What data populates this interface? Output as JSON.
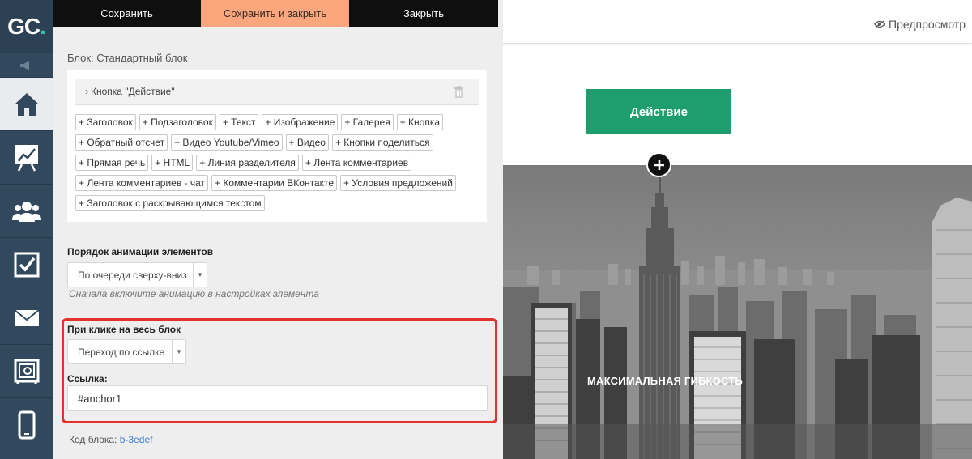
{
  "logo": {
    "text": "GC",
    "dot": "."
  },
  "nav": {
    "items": [
      {
        "icon": "home-icon"
      },
      {
        "icon": "chart-board-icon"
      },
      {
        "icon": "users-icon"
      },
      {
        "icon": "checkbox-icon"
      },
      {
        "icon": "mail-icon"
      },
      {
        "icon": "safe-icon"
      },
      {
        "icon": "mobile-icon"
      }
    ]
  },
  "toolbar": {
    "save_label": "Сохранить",
    "save_close_label": "Сохранить и закрыть",
    "close_label": "Закрыть"
  },
  "editor": {
    "block_title": "Блок: Стандартный блок",
    "element_name": "Кнопка \"Действие\"",
    "add_tags": [
      "+ Заголовок",
      "+ Подзаголовок",
      "+ Текст",
      "+ Изображение",
      "+ Галерея",
      "+ Кнопка",
      "+ Обратный отсчет",
      "+ Видео Youtube/Vimeo",
      "+ Видео",
      "+ Кнопки поделиться",
      "+ Прямая речь",
      "+ HTML",
      "+ Линия разделителя",
      "+ Лента комментариев",
      "+ Лента комментариев - чат",
      "+ Комментарии ВКонтакте",
      "+ Условия предложений",
      "+ Заголовок с раскрывающимся текстом"
    ],
    "animation_label": "Порядок анимации элементов",
    "animation_value": "По очереди сверху-вниз",
    "animation_hint": "Сначала включите анимацию в настройках элемента",
    "click_label": "При клике на весь блок",
    "click_value": "Переход по ссылке",
    "link_label": "Ссылка:",
    "link_value": "#anchor1",
    "code_label": "Код блока:",
    "code_value": "b-3edef"
  },
  "preview": {
    "preview_link": "Предпросмотр",
    "action_button": "Действие",
    "caption": "МАКСИМАЛЬНАЯ ГИБКОСТЬ"
  },
  "colors": {
    "nav_bg": "#32495d",
    "accent_orange": "#fca67e",
    "action_green": "#1e9e6f",
    "highlight_red": "#e1322c",
    "logo_dot": "#2fc3ae"
  }
}
